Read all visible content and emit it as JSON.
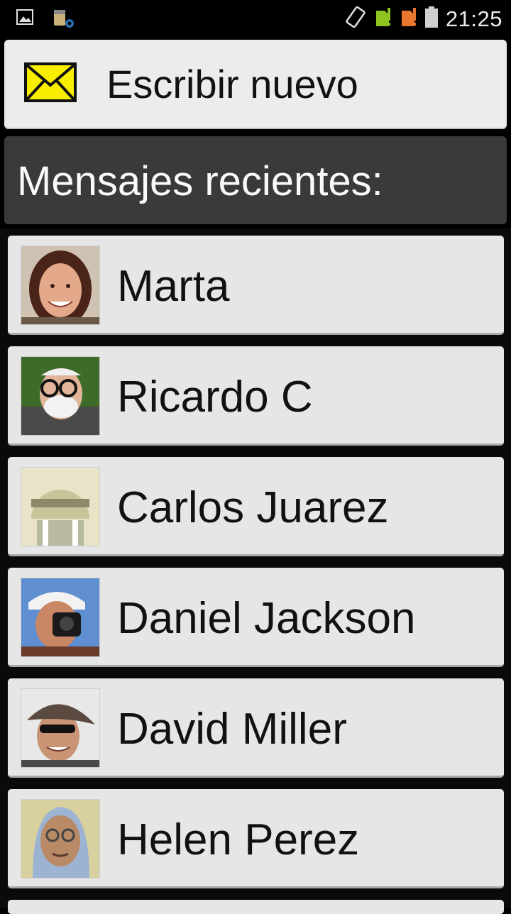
{
  "statusbar": {
    "time": "21:25",
    "left_icons": [
      "gallery-icon",
      "sd-card-settings-icon"
    ],
    "right_icons": [
      "screen-rotation-icon",
      "sim1-signal-icon",
      "sim2-signal-icon",
      "battery-icon"
    ]
  },
  "compose": {
    "label": "Escribir nuevo",
    "icon": "envelope-icon",
    "icon_color": "#f8ee00"
  },
  "recent": {
    "title": "Mensajes recientes:",
    "items": [
      {
        "name": "Marta",
        "avatar": "contact-photo"
      },
      {
        "name": "Ricardo C",
        "avatar": "contact-photo"
      },
      {
        "name": "Carlos Juarez",
        "avatar": "contact-photo"
      },
      {
        "name": "Daniel Jackson",
        "avatar": "contact-photo"
      },
      {
        "name": "David Miller",
        "avatar": "contact-photo"
      },
      {
        "name": "Helen Perez",
        "avatar": "contact-photo"
      }
    ]
  }
}
